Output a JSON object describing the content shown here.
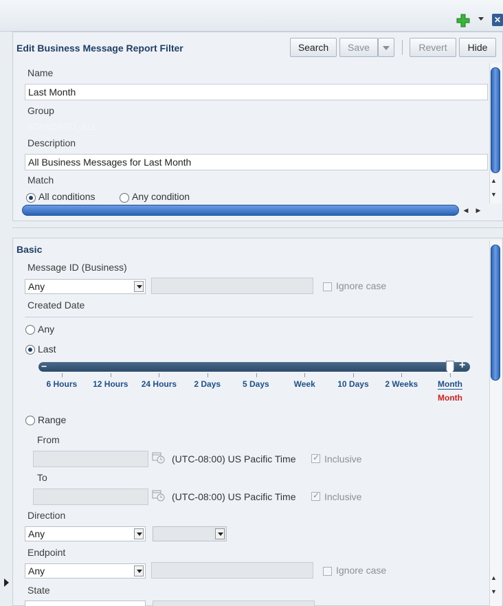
{
  "toolbar": {
    "plus_icon": "green-plus-icon",
    "close_icon": "close-icon"
  },
  "filter_panel": {
    "title": "Edit Business Message Report Filter",
    "buttons": {
      "search": "Search",
      "save": "Save",
      "revert": "Revert",
      "hide": "Hide"
    },
    "name_label": "Name",
    "name_value": "Last Month",
    "group_label": "Group",
    "group_value": "STANDARD_ALL",
    "description_label": "Description",
    "description_value": "All Business Messages for Last Month",
    "match_label": "Match",
    "match_options": {
      "all": "All conditions",
      "any": "Any condition"
    },
    "match_selected": "all"
  },
  "basic_panel": {
    "title": "Basic",
    "message_id_label": "Message ID (Business)",
    "message_id_select": "Any",
    "ignore_case_label": "Ignore case",
    "created_date_label": "Created Date",
    "date_options": {
      "any": "Any",
      "last": "Last",
      "range": "Range"
    },
    "date_selected": "last",
    "slider": {
      "ticks": [
        "6 Hours",
        "12 Hours",
        "24 Hours",
        "2 Days",
        "5 Days",
        "Week",
        "10 Days",
        "2 Weeks",
        "Month"
      ],
      "selected": "Month",
      "selected_index": 8
    },
    "from_label": "From",
    "to_label": "To",
    "timezone": "(UTC-08:00) US Pacific Time",
    "inclusive_label": "Inclusive",
    "direction_label": "Direction",
    "direction_select": "Any",
    "endpoint_label": "Endpoint",
    "endpoint_select": "Any",
    "endpoint_ignore_case_label": "Ignore case",
    "state_label": "State"
  }
}
